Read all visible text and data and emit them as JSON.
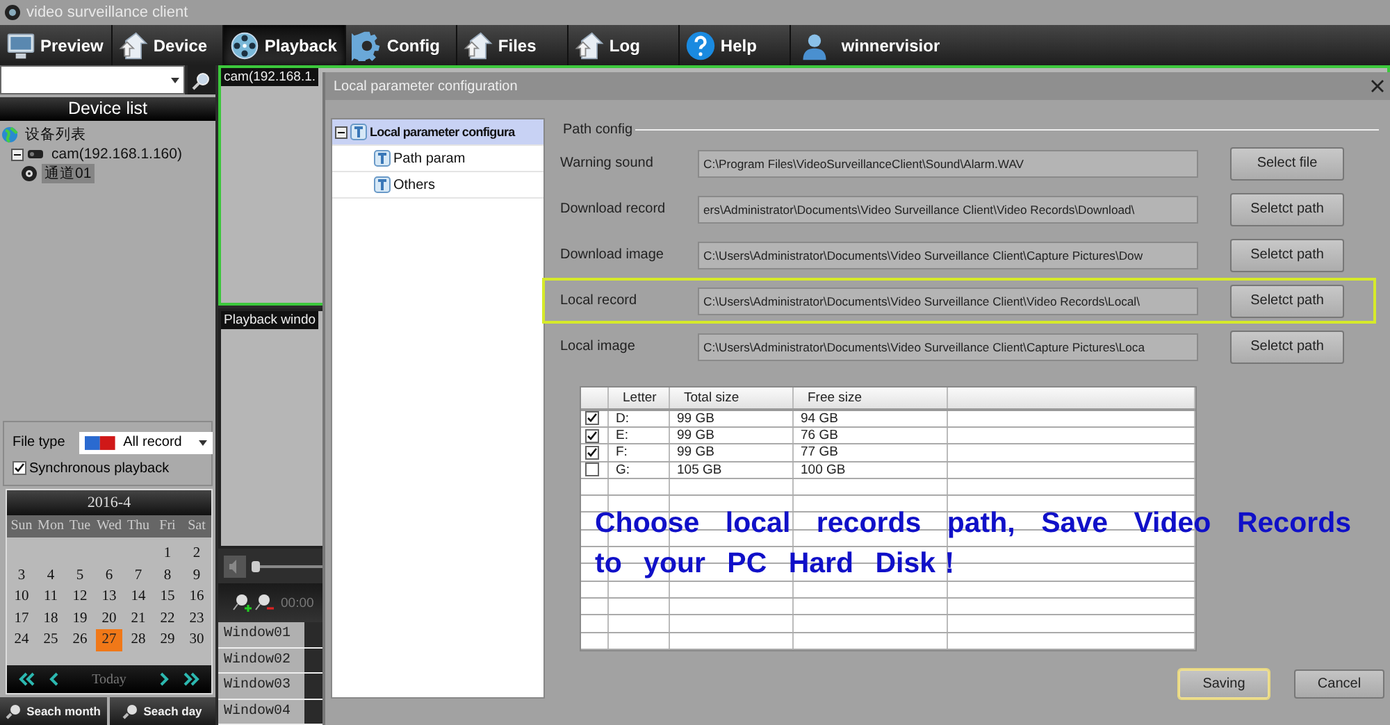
{
  "window": {
    "title": "video surveillance client"
  },
  "toolbar": [
    {
      "label": "Preview",
      "selected": false
    },
    {
      "label": "Device",
      "selected": false
    },
    {
      "label": "Playback",
      "selected": true
    },
    {
      "label": "Config",
      "selected": false
    },
    {
      "label": "Files",
      "selected": false
    },
    {
      "label": "Log",
      "selected": false
    },
    {
      "label": "Help",
      "selected": false
    }
  ],
  "user": {
    "name": "winnervisior"
  },
  "device_list": {
    "title": "Device list",
    "tree": [
      {
        "label": "设备列表",
        "children": [
          {
            "label": "cam(192.168.1.160)",
            "expanded": true,
            "selected": false,
            "children": [
              {
                "label": "通道01",
                "selected": true
              }
            ]
          }
        ]
      }
    ]
  },
  "file_type": {
    "label": "File type",
    "value": "All record"
  },
  "sync_playback": {
    "label": "Synchronous playback",
    "checked": true
  },
  "calendar": {
    "month": "2016-4",
    "weekdays": [
      "Sun",
      "Mon",
      "Tue",
      "Wed",
      "Thu",
      "Fri",
      "Sat"
    ],
    "weeks": [
      {
        "days": [
          {
            "day": "1",
            "selected": false
          },
          {
            "day": "2",
            "selected": false
          }
        ]
      },
      {
        "days": [
          {
            "day": "3",
            "selected": false
          },
          {
            "day": "4",
            "selected": false
          },
          {
            "day": "5",
            "selected": false
          },
          {
            "day": "6",
            "selected": false
          },
          {
            "day": "7",
            "selected": false
          },
          {
            "day": "8",
            "selected": false
          },
          {
            "day": "9",
            "selected": false
          }
        ]
      },
      {
        "days": [
          {
            "day": "10",
            "selected": false
          },
          {
            "day": "11",
            "selected": false
          },
          {
            "day": "12",
            "selected": false
          },
          {
            "day": "13",
            "selected": false
          },
          {
            "day": "14",
            "selected": false
          },
          {
            "day": "15",
            "selected": false
          },
          {
            "day": "16",
            "selected": false
          }
        ]
      },
      {
        "days": [
          {
            "day": "17",
            "selected": false
          },
          {
            "day": "18",
            "selected": false
          },
          {
            "day": "19",
            "selected": false
          },
          {
            "day": "20",
            "selected": false
          },
          {
            "day": "21",
            "selected": false
          },
          {
            "day": "22",
            "selected": false
          },
          {
            "day": "23",
            "selected": false
          }
        ]
      },
      {
        "days": [
          {
            "day": "24",
            "selected": false
          },
          {
            "day": "25",
            "selected": false
          },
          {
            "day": "26",
            "selected": false
          },
          {
            "day": "27",
            "selected": true
          },
          {
            "day": "28",
            "selected": false
          },
          {
            "day": "29",
            "selected": false
          },
          {
            "day": "30",
            "selected": false
          }
        ]
      }
    ],
    "today": "Today"
  },
  "search_buttons": [
    "Seach month",
    "Seach day"
  ],
  "video_panels": [
    {
      "title": "cam(192.168.1.",
      "active": true
    },
    {
      "title": "Playback windo",
      "active": false
    }
  ],
  "volume": {
    "level": 0.0
  },
  "timeline": {
    "time": "00:00",
    "windows": [
      "Window01",
      "Window02",
      "Window03",
      "Window04"
    ]
  },
  "dialog": {
    "title": "Local parameter configuration",
    "nav": [
      {
        "label": "Local parameter configura",
        "expanded": true,
        "selected": true,
        "children": [
          {
            "label": "Path param",
            "selected": false
          },
          {
            "label": "Others",
            "selected": false
          }
        ]
      }
    ],
    "group": "Path config",
    "paths": [
      {
        "label": "Warning sound",
        "value": "C:\\Program Files\\VideoSurveillanceClient\\Sound\\Alarm.WAV",
        "button": "Select file",
        "highlighted": false
      },
      {
        "label": "Download record",
        "value": "ers\\Administrator\\Documents\\Video Surveillance Client\\Video Records\\Download\\",
        "button": "Seletct path",
        "highlighted": false
      },
      {
        "label": "Download image",
        "value": "C:\\Users\\Administrator\\Documents\\Video Surveillance Client\\Capture Pictures\\Dow",
        "button": "Seletct path",
        "highlighted": false
      },
      {
        "label": "Local record",
        "value": "C:\\Users\\Administrator\\Documents\\Video Surveillance Client\\Video Records\\Local\\",
        "button": "Seletct path",
        "highlighted": true
      },
      {
        "label": "Local image",
        "value": "C:\\Users\\Administrator\\Documents\\Video Surveillance Client\\Capture Pictures\\Loca",
        "button": "Seletct path",
        "highlighted": false
      }
    ],
    "disks": {
      "columns": [
        "Letter",
        "Total size",
        "Free size"
      ],
      "rows": [
        {
          "checked": true,
          "letter": "D:",
          "total": "99 GB",
          "free": "94 GB"
        },
        {
          "checked": true,
          "letter": "E:",
          "total": "99 GB",
          "free": "76 GB"
        },
        {
          "checked": true,
          "letter": "F:",
          "total": "99 GB",
          "free": "77 GB"
        },
        {
          "checked": false,
          "letter": "G:",
          "total": "105 GB",
          "free": "100 GB"
        }
      ]
    },
    "annotation": "Choose local records path, Save Video Records to your PC Hard Disk！",
    "buttons": [
      {
        "label": "Saving",
        "focused": true
      },
      {
        "label": "Cancel",
        "focused": false
      }
    ]
  }
}
